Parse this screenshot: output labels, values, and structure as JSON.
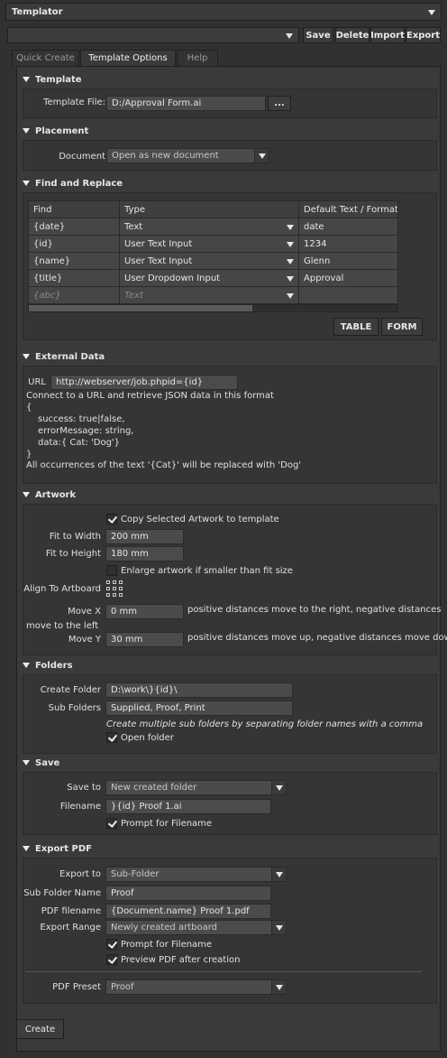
{
  "title_bar": {
    "title": "Templator"
  },
  "toolbar": {
    "save": "Save",
    "delete": "Delete",
    "import": "Import",
    "export": "Export"
  },
  "tabs": [
    "Quick Create",
    "Template Options",
    "Help"
  ],
  "template": {
    "heading": "Template",
    "file_label": "Template File:",
    "file_value": "D:/Approval Form.ai",
    "browse": "..."
  },
  "placement": {
    "heading": "Placement",
    "document_label": "Document",
    "document_value": "Open as new document"
  },
  "find_replace": {
    "heading": "Find and Replace",
    "columns": [
      "Find",
      "Type",
      "Default Text / Format"
    ],
    "rows": [
      {
        "find": "{date}",
        "type": "Text",
        "default": "date"
      },
      {
        "find": "{id}",
        "type": "User Text Input",
        "default": "1234"
      },
      {
        "find": "{name}",
        "type": "User Text Input",
        "default": "Glenn"
      },
      {
        "find": "{title}",
        "type": "User Dropdown Input",
        "default": "Approval"
      },
      {
        "find": "{abc}",
        "type": "Text",
        "default": ""
      }
    ],
    "table_btn": "TABLE",
    "form_btn": "FORM"
  },
  "external": {
    "heading": "External Data",
    "url_label": "URL",
    "url_value": "http://webserver/job.phpid={id}",
    "lines": [
      "Connect to a URL and retrieve JSON data in this format",
      "{",
      "success: true|false,",
      "errorMessage: string,",
      "data:{ Cat: 'Dog'}",
      "}",
      "All occurrences of the text '{Cat}' will be replaced with 'Dog'"
    ]
  },
  "artwork": {
    "heading": "Artwork",
    "copy_label": "Copy Selected Artwork to template",
    "fit_width_label": "Fit to Width",
    "fit_width_value": "200 mm",
    "fit_height_label": "Fit to Height",
    "fit_height_value": "180 mm",
    "enlarge_label": "Enlarge artwork if smaller than fit size",
    "align_label": "Align To Artboard",
    "move_x_label": "Move X",
    "move_x_value": "0 mm",
    "move_x_hint_1": "positive distances move to the right, negative distances",
    "move_x_hint_2": "move to the left",
    "move_y_label": "Move Y",
    "move_y_value": "30 mm",
    "move_y_hint": "positive distances move up, negative distances move down"
  },
  "folders": {
    "heading": "Folders",
    "create_label": "Create Folder",
    "create_value": "D:\\work\\}{id}\\",
    "sub_label": "Sub Folders",
    "sub_value": "Supplied, Proof, Print",
    "hint": "Create multiple sub folders by separating folder names with a comma",
    "open_label": "Open folder"
  },
  "save": {
    "heading": "Save",
    "save_to_label": "Save to",
    "save_to_value": "New created folder",
    "filename_label": "Filename",
    "filename_value": "}{id} Proof 1.ai",
    "prompt_label": "Prompt for Filename"
  },
  "export_pdf": {
    "heading": "Export PDF",
    "export_to_label": "Export to",
    "export_to_value": "Sub-Folder",
    "sub_name_label": "Sub Folder Name",
    "sub_name_value": "Proof",
    "pdf_filename_label": "PDF filename",
    "pdf_filename_value": "{Document.name} Proof 1.pdf",
    "range_label": "Export Range",
    "range_value": "Newly created artboard",
    "prompt_label": "Prompt for Filename",
    "preview_label": "Preview PDF after creation",
    "preset_label": "PDF Preset",
    "preset_value": "Proof"
  },
  "create_button": "Create"
}
